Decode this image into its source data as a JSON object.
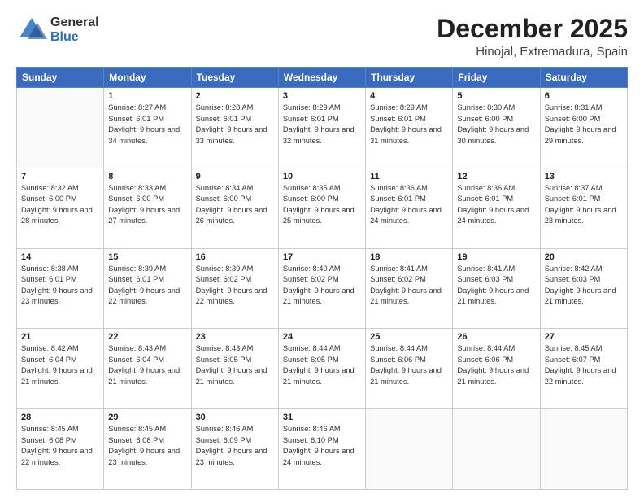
{
  "logo": {
    "line1": "General",
    "line2": "Blue"
  },
  "header": {
    "title": "December 2025",
    "subtitle": "Hinojal, Extremadura, Spain"
  },
  "weekdays": [
    "Sunday",
    "Monday",
    "Tuesday",
    "Wednesday",
    "Thursday",
    "Friday",
    "Saturday"
  ],
  "weeks": [
    [
      {
        "day": "",
        "sunrise": "",
        "sunset": "",
        "daylight": ""
      },
      {
        "day": "1",
        "sunrise": "Sunrise: 8:27 AM",
        "sunset": "Sunset: 6:01 PM",
        "daylight": "Daylight: 9 hours and 34 minutes."
      },
      {
        "day": "2",
        "sunrise": "Sunrise: 8:28 AM",
        "sunset": "Sunset: 6:01 PM",
        "daylight": "Daylight: 9 hours and 33 minutes."
      },
      {
        "day": "3",
        "sunrise": "Sunrise: 8:29 AM",
        "sunset": "Sunset: 6:01 PM",
        "daylight": "Daylight: 9 hours and 32 minutes."
      },
      {
        "day": "4",
        "sunrise": "Sunrise: 8:29 AM",
        "sunset": "Sunset: 6:01 PM",
        "daylight": "Daylight: 9 hours and 31 minutes."
      },
      {
        "day": "5",
        "sunrise": "Sunrise: 8:30 AM",
        "sunset": "Sunset: 6:00 PM",
        "daylight": "Daylight: 9 hours and 30 minutes."
      },
      {
        "day": "6",
        "sunrise": "Sunrise: 8:31 AM",
        "sunset": "Sunset: 6:00 PM",
        "daylight": "Daylight: 9 hours and 29 minutes."
      }
    ],
    [
      {
        "day": "7",
        "sunrise": "Sunrise: 8:32 AM",
        "sunset": "Sunset: 6:00 PM",
        "daylight": "Daylight: 9 hours and 28 minutes."
      },
      {
        "day": "8",
        "sunrise": "Sunrise: 8:33 AM",
        "sunset": "Sunset: 6:00 PM",
        "daylight": "Daylight: 9 hours and 27 minutes."
      },
      {
        "day": "9",
        "sunrise": "Sunrise: 8:34 AM",
        "sunset": "Sunset: 6:00 PM",
        "daylight": "Daylight: 9 hours and 26 minutes."
      },
      {
        "day": "10",
        "sunrise": "Sunrise: 8:35 AM",
        "sunset": "Sunset: 6:00 PM",
        "daylight": "Daylight: 9 hours and 25 minutes."
      },
      {
        "day": "11",
        "sunrise": "Sunrise: 8:36 AM",
        "sunset": "Sunset: 6:01 PM",
        "daylight": "Daylight: 9 hours and 24 minutes."
      },
      {
        "day": "12",
        "sunrise": "Sunrise: 8:36 AM",
        "sunset": "Sunset: 6:01 PM",
        "daylight": "Daylight: 9 hours and 24 minutes."
      },
      {
        "day": "13",
        "sunrise": "Sunrise: 8:37 AM",
        "sunset": "Sunset: 6:01 PM",
        "daylight": "Daylight: 9 hours and 23 minutes."
      }
    ],
    [
      {
        "day": "14",
        "sunrise": "Sunrise: 8:38 AM",
        "sunset": "Sunset: 6:01 PM",
        "daylight": "Daylight: 9 hours and 23 minutes."
      },
      {
        "day": "15",
        "sunrise": "Sunrise: 8:39 AM",
        "sunset": "Sunset: 6:01 PM",
        "daylight": "Daylight: 9 hours and 22 minutes."
      },
      {
        "day": "16",
        "sunrise": "Sunrise: 8:39 AM",
        "sunset": "Sunset: 6:02 PM",
        "daylight": "Daylight: 9 hours and 22 minutes."
      },
      {
        "day": "17",
        "sunrise": "Sunrise: 8:40 AM",
        "sunset": "Sunset: 6:02 PM",
        "daylight": "Daylight: 9 hours and 21 minutes."
      },
      {
        "day": "18",
        "sunrise": "Sunrise: 8:41 AM",
        "sunset": "Sunset: 6:02 PM",
        "daylight": "Daylight: 9 hours and 21 minutes."
      },
      {
        "day": "19",
        "sunrise": "Sunrise: 8:41 AM",
        "sunset": "Sunset: 6:03 PM",
        "daylight": "Daylight: 9 hours and 21 minutes."
      },
      {
        "day": "20",
        "sunrise": "Sunrise: 8:42 AM",
        "sunset": "Sunset: 6:03 PM",
        "daylight": "Daylight: 9 hours and 21 minutes."
      }
    ],
    [
      {
        "day": "21",
        "sunrise": "Sunrise: 8:42 AM",
        "sunset": "Sunset: 6:04 PM",
        "daylight": "Daylight: 9 hours and 21 minutes."
      },
      {
        "day": "22",
        "sunrise": "Sunrise: 8:43 AM",
        "sunset": "Sunset: 6:04 PM",
        "daylight": "Daylight: 9 hours and 21 minutes."
      },
      {
        "day": "23",
        "sunrise": "Sunrise: 8:43 AM",
        "sunset": "Sunset: 6:05 PM",
        "daylight": "Daylight: 9 hours and 21 minutes."
      },
      {
        "day": "24",
        "sunrise": "Sunrise: 8:44 AM",
        "sunset": "Sunset: 6:05 PM",
        "daylight": "Daylight: 9 hours and 21 minutes."
      },
      {
        "day": "25",
        "sunrise": "Sunrise: 8:44 AM",
        "sunset": "Sunset: 6:06 PM",
        "daylight": "Daylight: 9 hours and 21 minutes."
      },
      {
        "day": "26",
        "sunrise": "Sunrise: 8:44 AM",
        "sunset": "Sunset: 6:06 PM",
        "daylight": "Daylight: 9 hours and 21 minutes."
      },
      {
        "day": "27",
        "sunrise": "Sunrise: 8:45 AM",
        "sunset": "Sunset: 6:07 PM",
        "daylight": "Daylight: 9 hours and 22 minutes."
      }
    ],
    [
      {
        "day": "28",
        "sunrise": "Sunrise: 8:45 AM",
        "sunset": "Sunset: 6:08 PM",
        "daylight": "Daylight: 9 hours and 22 minutes."
      },
      {
        "day": "29",
        "sunrise": "Sunrise: 8:45 AM",
        "sunset": "Sunset: 6:08 PM",
        "daylight": "Daylight: 9 hours and 23 minutes."
      },
      {
        "day": "30",
        "sunrise": "Sunrise: 8:46 AM",
        "sunset": "Sunset: 6:09 PM",
        "daylight": "Daylight: 9 hours and 23 minutes."
      },
      {
        "day": "31",
        "sunrise": "Sunrise: 8:46 AM",
        "sunset": "Sunset: 6:10 PM",
        "daylight": "Daylight: 9 hours and 24 minutes."
      },
      {
        "day": "",
        "sunrise": "",
        "sunset": "",
        "daylight": ""
      },
      {
        "day": "",
        "sunrise": "",
        "sunset": "",
        "daylight": ""
      },
      {
        "day": "",
        "sunrise": "",
        "sunset": "",
        "daylight": ""
      }
    ]
  ]
}
